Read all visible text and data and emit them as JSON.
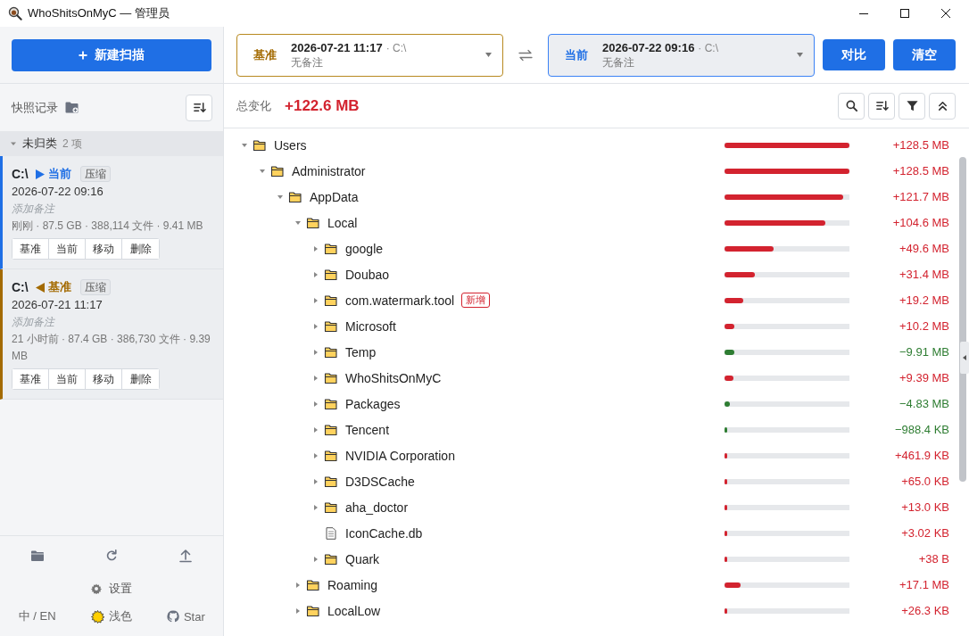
{
  "window": {
    "title": "WhoShitsOnMyC — 管理员"
  },
  "sidebar": {
    "new_scan_button": "新建扫描",
    "snapshots_title": "快照记录",
    "groups": [
      {
        "name": "未归类",
        "count": "2 项",
        "expanded": true,
        "snapshots": [
          {
            "drive": "C:\\",
            "kind": "current",
            "role_label": "当前",
            "tag": "压缩",
            "date": "2026-07-22 09:16",
            "note": "添加备注",
            "meta": "刚刚 · 87.5 GB · 388,114 文件 · 9.41 MB",
            "actions": [
              "基准",
              "当前",
              "移动",
              "删除"
            ]
          },
          {
            "drive": "C:\\",
            "kind": "baseline",
            "role_label": "基准",
            "tag": "压缩",
            "date": "2026-07-21 11:17",
            "note": "添加备注",
            "meta": "21 小时前 · 87.4 GB · 386,730 文件 · 9.39 MB",
            "actions": [
              "基准",
              "当前",
              "移动",
              "删除"
            ]
          }
        ]
      }
    ],
    "footer": {
      "settings": "设置",
      "language": "中 / EN",
      "theme": "浅色",
      "star": "Star"
    }
  },
  "compare": {
    "selectors": [
      {
        "kind": "baseline",
        "label": "基准",
        "date": "2026-07-21 11:17",
        "path": "· C:\\",
        "note": "无备注"
      },
      {
        "kind": "current",
        "label": "当前",
        "date": "2026-07-22 09:16",
        "path": "· C:\\",
        "note": "无备注"
      }
    ],
    "buttons": [
      "对比",
      "清空"
    ]
  },
  "summary": {
    "label": "总变化",
    "value": "+122.6 MB"
  },
  "tree": [
    {
      "name": "Users",
      "kind": "folder",
      "expanded": true,
      "level": 1,
      "change": "+128.5 MB",
      "color": "#d3232f",
      "children": [
        {
          "name": "Administrator",
          "kind": "folder",
          "expanded": true,
          "level": 1,
          "change": "+128.5 MB",
          "color": "#d3232f",
          "children": [
            {
              "name": "AppData",
              "kind": "folder",
              "expanded": true,
              "level": 0.95,
              "change": "+121.7 MB",
              "color": "#d3232f",
              "children": [
                {
                  "name": "Local",
                  "kind": "folder",
                  "expanded": true,
                  "level": 0.81,
                  "change": "+104.6 MB",
                  "color": "#d3232f",
                  "children": [
                    {
                      "name": "google",
                      "kind": "folder",
                      "expanded": false,
                      "level": 0.39,
                      "change": "+49.6 MB",
                      "color": "#d3232f"
                    },
                    {
                      "name": "Doubao",
                      "kind": "folder",
                      "expanded": false,
                      "level": 0.24,
                      "change": "+31.4 MB",
                      "color": "#d3232f"
                    },
                    {
                      "name": "com.watermark.tool",
                      "kind": "folder",
                      "expanded": false,
                      "badge": "新增",
                      "level": 0.15,
                      "change": "+19.2 MB",
                      "color": "#d3232f"
                    },
                    {
                      "name": "Microsoft",
                      "kind": "folder",
                      "expanded": false,
                      "level": 0.08,
                      "change": "+10.2 MB",
                      "color": "#d3232f"
                    },
                    {
                      "name": "Temp",
                      "kind": "folder",
                      "expanded": false,
                      "level": 0.08,
                      "change": "−9.91 MB",
                      "color": "#2e7d32"
                    },
                    {
                      "name": "WhoShitsOnMyC",
                      "kind": "folder",
                      "expanded": false,
                      "level": 0.07,
                      "change": "+9.39 MB",
                      "color": "#d3232f"
                    },
                    {
                      "name": "Packages",
                      "kind": "folder",
                      "expanded": false,
                      "level": 0.04,
                      "change": "−4.83 MB",
                      "color": "#2e7d32"
                    },
                    {
                      "name": "Tencent",
                      "kind": "folder",
                      "expanded": false,
                      "level": 0.02,
                      "change": "−988.4 KB",
                      "color": "#2e7d32"
                    },
                    {
                      "name": "NVIDIA Corporation",
                      "kind": "folder",
                      "expanded": false,
                      "level": 0.02,
                      "change": "+461.9 KB",
                      "color": "#d3232f"
                    },
                    {
                      "name": "D3DSCache",
                      "kind": "folder",
                      "expanded": false,
                      "level": 0.02,
                      "change": "+65.0 KB",
                      "color": "#d3232f"
                    },
                    {
                      "name": "aha_doctor",
                      "kind": "folder",
                      "expanded": false,
                      "level": 0.02,
                      "change": "+13.0 KB",
                      "color": "#d3232f"
                    },
                    {
                      "name": "IconCache.db",
                      "kind": "file",
                      "level": 0.02,
                      "change": "+3.02 KB",
                      "color": "#d3232f"
                    },
                    {
                      "name": "Quark",
                      "kind": "folder",
                      "expanded": false,
                      "level": 0.02,
                      "change": "+38 B",
                      "color": "#d3232f"
                    }
                  ]
                },
                {
                  "name": "Roaming",
                  "kind": "folder",
                  "expanded": false,
                  "level": 0.13,
                  "change": "+17.1 MB",
                  "color": "#d3232f"
                },
                {
                  "name": "LocalLow",
                  "kind": "folder",
                  "expanded": false,
                  "level": 0.02,
                  "change": "+26.3 KB",
                  "color": "#d3232f"
                }
              ]
            }
          ]
        }
      ]
    }
  ]
}
